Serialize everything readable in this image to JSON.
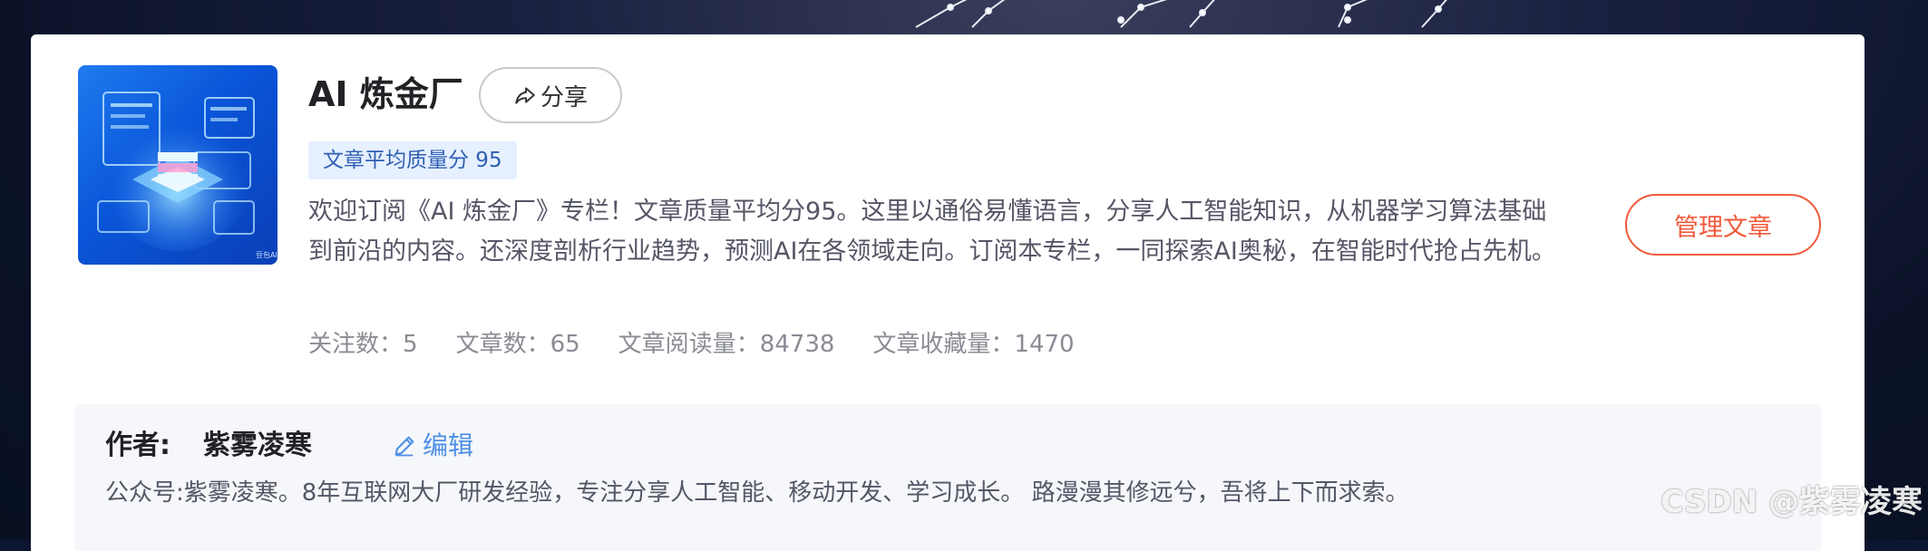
{
  "column": {
    "title": "AI 炼金厂",
    "share_label": "分享",
    "quality_tag": "文章平均质量分 95",
    "description": "欢迎订阅《AI 炼金厂》专栏！文章质量平均分95。这里以通俗易懂语言，分享人工智能知识，从机器学习算法基础到前沿的内容。还深度剖析行业趋势，预测AI在各领域走向。订阅本专栏，一同探索AI奥秘，在智能时代抢占先机。",
    "stats": [
      {
        "label": "关注数：",
        "value": "5"
      },
      {
        "label": "文章数：",
        "value": "65"
      },
      {
        "label": "文章阅读量：",
        "value": "84738"
      },
      {
        "label": "文章收藏量：",
        "value": "1470"
      }
    ],
    "manage_label": "管理文章",
    "cover_icon": "ai-illustration"
  },
  "author": {
    "label": "作者:",
    "name": "紫雾凌寒",
    "edit_label": "编辑",
    "bio": "公众号:紫雾凌寒。8年互联网大厂研发经验，专注分享人工智能、移动开发、学习成长。 路漫漫其修远兮，吾将上下而求索。"
  },
  "watermark": "CSDN @紫雾凌寒",
  "colors": {
    "accent_orange": "#f0593a",
    "tag_bg": "#e6f0ff",
    "tag_text": "#2f5fb3",
    "link_blue": "#4f8fe8"
  }
}
